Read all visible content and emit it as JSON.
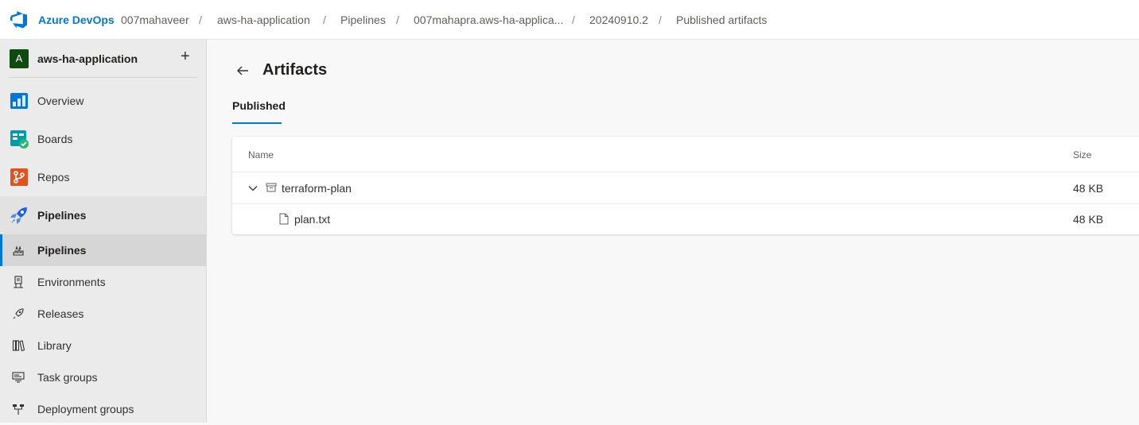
{
  "header": {
    "brand": "Azure DevOps",
    "breadcrumbs": [
      "007mahaveer",
      "aws-ha-application",
      "Pipelines",
      "007mahapra.aws-ha-applica...",
      "20240910.2",
      "Published artifacts"
    ],
    "separator": "/"
  },
  "sidebar": {
    "project": {
      "initial": "A",
      "name": "aws-ha-application",
      "add_symbol": "+"
    },
    "nav": [
      {
        "label": "Overview",
        "icon": "overview-icon"
      },
      {
        "label": "Boards",
        "icon": "boards-icon"
      },
      {
        "label": "Repos",
        "icon": "repos-icon"
      },
      {
        "label": "Pipelines",
        "icon": "pipelines-icon",
        "selected": true
      }
    ],
    "sub_items": [
      {
        "label": "Pipelines",
        "icon": "pipelines-rocket-icon",
        "active": true
      },
      {
        "label": "Environments",
        "icon": "environments-icon"
      },
      {
        "label": "Releases",
        "icon": "releases-icon"
      },
      {
        "label": "Library",
        "icon": "library-icon"
      },
      {
        "label": "Task groups",
        "icon": "task-groups-icon"
      },
      {
        "label": "Deployment groups",
        "icon": "deployment-groups-icon"
      }
    ]
  },
  "main": {
    "title": "Artifacts",
    "tabs": [
      {
        "label": "Published",
        "selected": true
      }
    ],
    "table": {
      "columns": {
        "name": "Name",
        "size": "Size"
      },
      "rows": [
        {
          "name": "terraform-plan",
          "size": "48 KB",
          "type": "artifact",
          "expanded": true
        },
        {
          "name": "plan.txt",
          "size": "48 KB",
          "type": "file"
        }
      ]
    }
  },
  "colors": {
    "accent": "#0078d4",
    "project_avatar": "#0e4a12"
  }
}
